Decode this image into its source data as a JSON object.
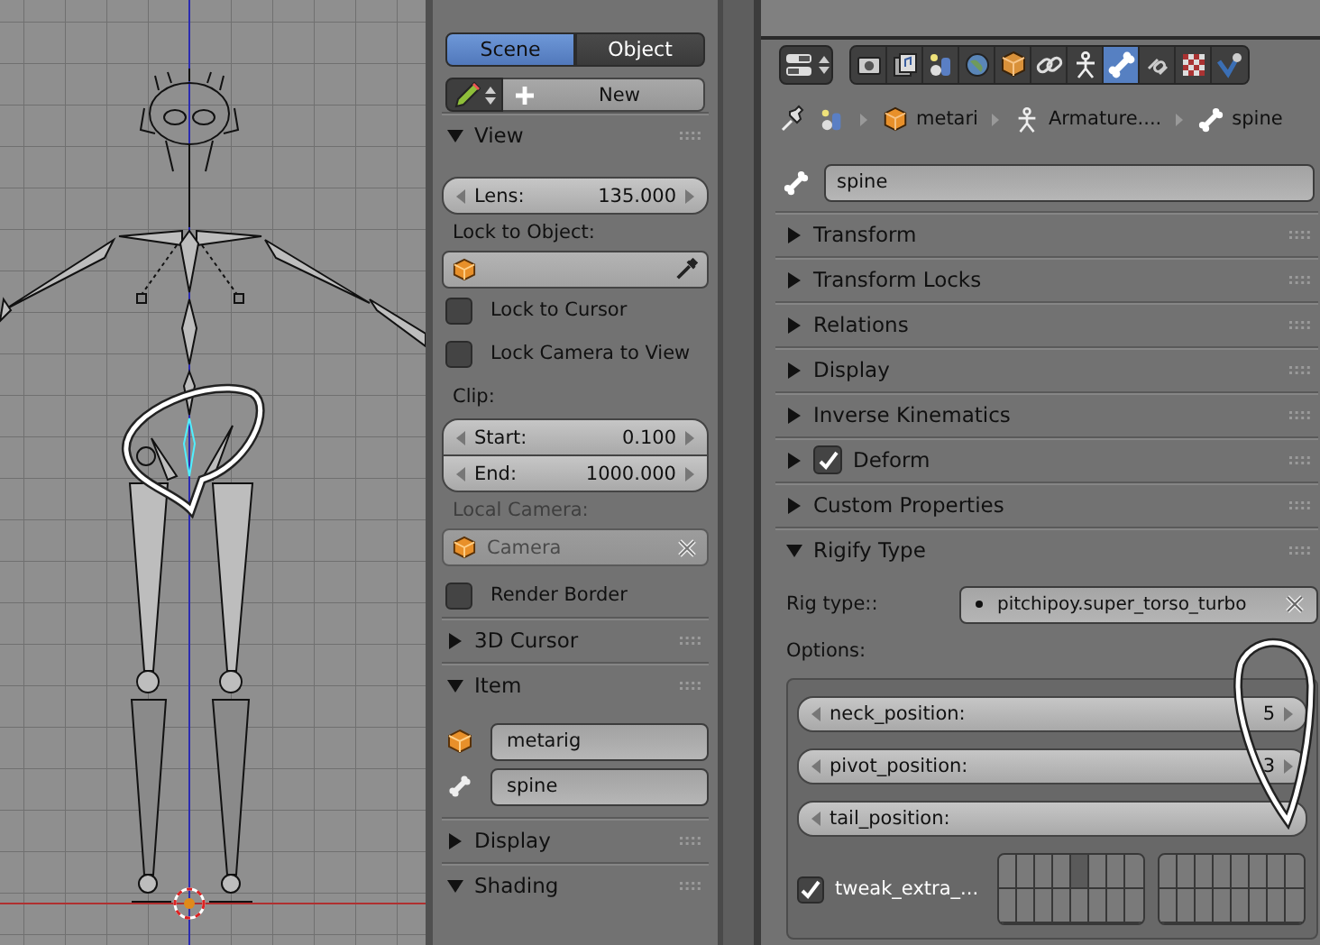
{
  "view3d_sidebar": {
    "mode_tabs": [
      {
        "label": "Scene",
        "selected": true
      },
      {
        "label": "Object",
        "selected": false
      }
    ],
    "new_button": "New",
    "panels": [
      {
        "kind": "view",
        "title": "View",
        "expanded": true,
        "lens": {
          "label": "Lens:",
          "value": "135.000"
        },
        "lock_object_label": "Lock to Object:",
        "options": [
          {
            "label": "Lock to Cursor",
            "checked": false
          },
          {
            "label": "Lock Camera to View",
            "checked": false
          }
        ],
        "clip_label": "Clip:",
        "clip": [
          {
            "label": "Start:",
            "value": "0.100"
          },
          {
            "label": "End:",
            "value": "1000.000"
          }
        ],
        "local_camera_label": "Local Camera:",
        "local_camera": {
          "value": "Camera",
          "disabled": true
        },
        "render_border": {
          "label": "Render Border",
          "checked": false
        }
      },
      {
        "title": "3D Cursor",
        "expanded": false
      },
      {
        "kind": "item",
        "title": "Item",
        "expanded": true,
        "object": "metarig",
        "bone": "spine"
      },
      {
        "title": "Display",
        "expanded": false
      },
      {
        "title": "Shading",
        "expanded": true
      }
    ]
  },
  "properties": {
    "context_tabs": [
      {
        "kind": "render",
        "selected": false
      },
      {
        "kind": "layers",
        "selected": false
      },
      {
        "kind": "scene",
        "selected": false
      },
      {
        "kind": "world",
        "selected": false
      },
      {
        "kind": "object",
        "selected": false
      },
      {
        "kind": "constraints",
        "selected": false
      },
      {
        "kind": "armature",
        "selected": false
      },
      {
        "kind": "bone",
        "selected": true
      },
      {
        "kind": "bone_constraints",
        "selected": false
      },
      {
        "kind": "texture",
        "selected": false
      },
      {
        "kind": "physics",
        "selected": false
      }
    ],
    "breadcrumb": [
      {
        "kind": "scene"
      },
      {
        "kind": "object",
        "text": "metari"
      },
      {
        "kind": "armature",
        "text": "Armature...."
      },
      {
        "kind": "bone",
        "text": "spine"
      }
    ],
    "bone_name": "spine",
    "panels": [
      {
        "title": "Transform",
        "expanded": false
      },
      {
        "title": "Transform Locks",
        "expanded": false
      },
      {
        "title": "Relations",
        "expanded": false
      },
      {
        "title": "Display",
        "expanded": false
      },
      {
        "title": "Inverse Kinematics",
        "expanded": false
      },
      {
        "kind": "toggle",
        "title": "Deform",
        "expanded": false,
        "checked": true
      },
      {
        "title": "Custom Properties",
        "expanded": false
      },
      {
        "kind": "rigify",
        "title": "Rigify Type",
        "expanded": true,
        "rig_type_label": "Rig type::",
        "rig_type": "pitchipoy.super_torso_turbo",
        "options_label": "Options:",
        "fields": [
          {
            "label": "neck_position:",
            "value": "5"
          },
          {
            "label": "pivot_position:",
            "value": "3"
          },
          {
            "label": "tail_position:"
          }
        ],
        "tweak": {
          "label": "tweak_extra_...",
          "checked": true,
          "layers": [
            [
              false,
              false,
              false,
              false,
              true,
              false,
              false,
              false,
              false,
              false,
              false,
              false,
              false,
              false,
              false,
              false
            ],
            [
              false,
              false,
              false,
              false,
              false,
              false,
              false,
              false,
              false,
              false,
              false,
              false,
              false,
              false,
              false,
              false
            ]
          ]
        }
      }
    ]
  }
}
